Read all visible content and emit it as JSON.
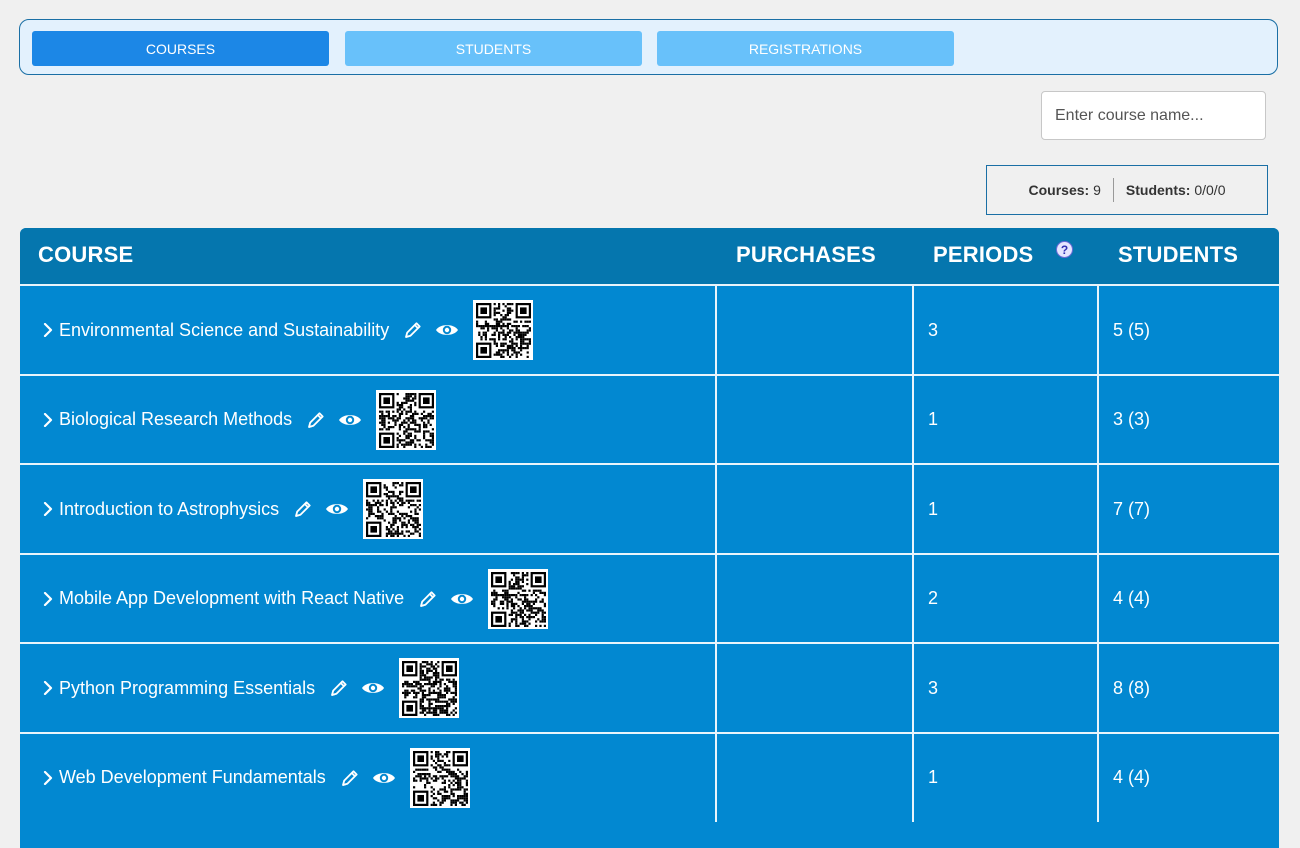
{
  "tabs": [
    {
      "label": "COURSES",
      "active": true
    },
    {
      "label": "STUDENTS",
      "active": false
    },
    {
      "label": "REGISTRATIONS",
      "active": false
    }
  ],
  "search": {
    "placeholder": "Enter course name..."
  },
  "stats": {
    "courses_label": "Courses:",
    "courses_value": "9",
    "students_label": "Students:",
    "students_value": "0/0/0"
  },
  "table": {
    "headers": {
      "course": "COURSE",
      "purchases": "PURCHASES",
      "periods": "PERIODS",
      "students": "STUDENTS",
      "help_icon": "?"
    },
    "rows": [
      {
        "name": "Environmental Science and Sustainability",
        "purchases": "",
        "periods": "3",
        "students": "5 (5)"
      },
      {
        "name": "Biological Research Methods",
        "purchases": "",
        "periods": "1",
        "students": "3 (3)"
      },
      {
        "name": "Introduction to Astrophysics",
        "purchases": "",
        "periods": "1",
        "students": "7 (7)"
      },
      {
        "name": "Mobile App Development with React Native",
        "purchases": "",
        "periods": "2",
        "students": "4 (4)"
      },
      {
        "name": "Python Programming Essentials",
        "purchases": "",
        "periods": "3",
        "students": "8 (8)"
      },
      {
        "name": "Web Development Fundamentals",
        "purchases": "",
        "periods": "1",
        "students": "4 (4)"
      }
    ]
  },
  "colors": {
    "tab_active": "#1c87e6",
    "tab_inactive": "#68c1fa",
    "table_header": "#0576ae",
    "table_row": "#0288d1"
  },
  "icons": {
    "expand": "chevron-right-icon",
    "edit": "pencil-icon",
    "view": "eye-icon",
    "qr": "qr-code-icon",
    "help": "help-icon"
  }
}
